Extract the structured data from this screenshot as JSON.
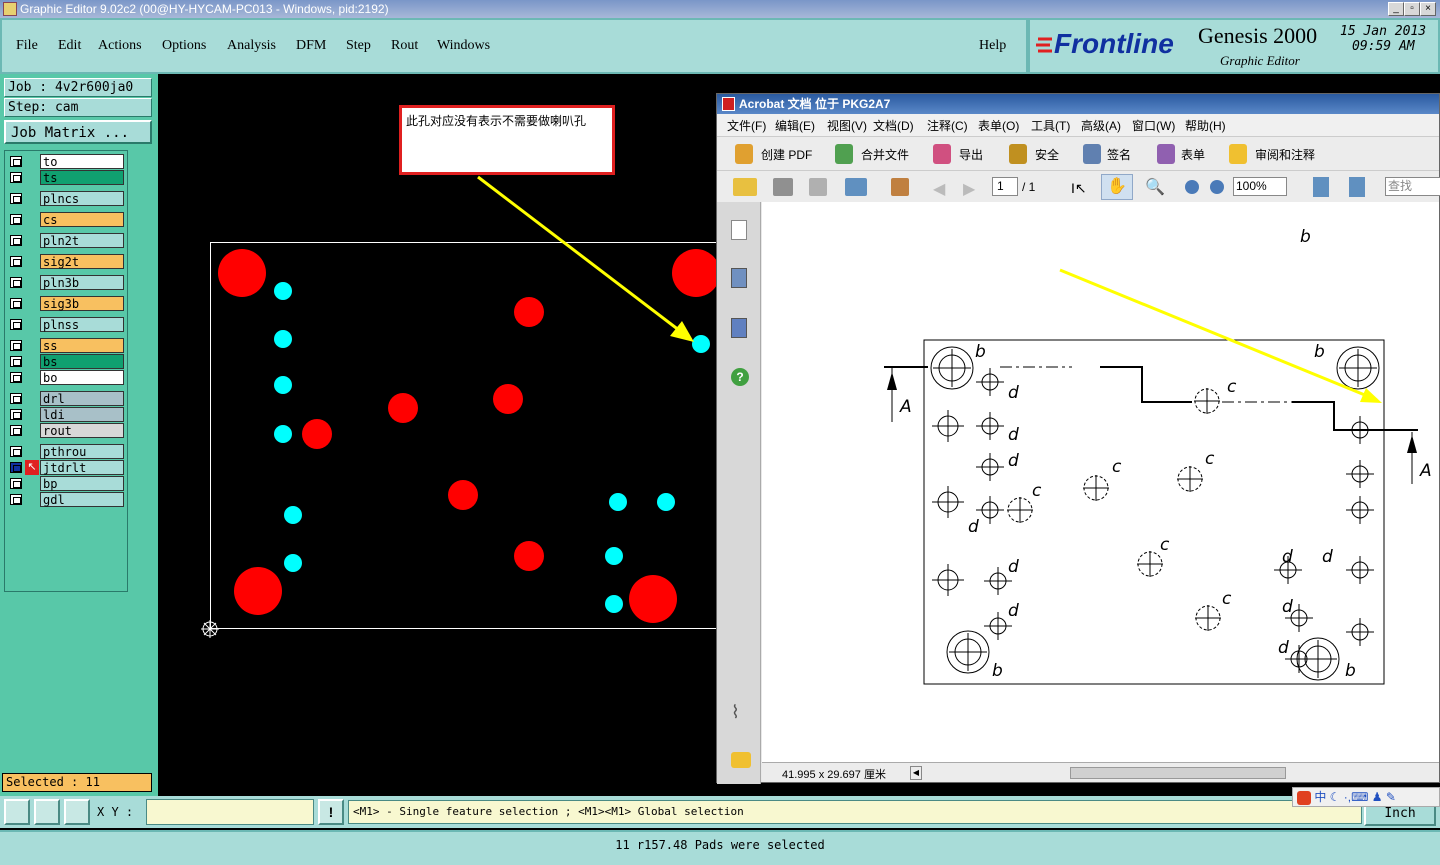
{
  "window": {
    "title": "Graphic Editor 9.02c2 (00@HY-HYCAM-PC013 - Windows, pid:2192)"
  },
  "menu": {
    "items": [
      "File",
      "Edit",
      "Actions",
      "Options",
      "Analysis",
      "DFM",
      "Step",
      "Rout",
      "Windows"
    ],
    "help": "Help"
  },
  "brand": {
    "logo": "Frontline",
    "product": "Genesis 2000",
    "subtitle": "Graphic Editor",
    "date": "15 Jan 2013",
    "time": "09:59 AM"
  },
  "job": {
    "job": "Job : 4v2r600ja0",
    "step": "Step: cam",
    "matrix_button": "Job Matrix ..."
  },
  "layers": [
    {
      "name": "to",
      "color": "#ffffff"
    },
    {
      "name": "ts",
      "color": "#10a070"
    },
    {
      "name": "plncs",
      "color": "#a8dcd8"
    },
    {
      "name": "cs",
      "color": "#f8c060"
    },
    {
      "name": "pln2t",
      "color": "#a8dcd8"
    },
    {
      "name": "sig2t",
      "color": "#f8c060"
    },
    {
      "name": "pln3b",
      "color": "#a8dcd8"
    },
    {
      "name": "sig3b",
      "color": "#f8c060"
    },
    {
      "name": "plnss",
      "color": "#a8dcd8"
    },
    {
      "name": "ss",
      "color": "#f8c060"
    },
    {
      "name": "bs",
      "color": "#10a070"
    },
    {
      "name": "bo",
      "color": "#ffffff"
    },
    {
      "name": "drl",
      "color": "#a8c0c8"
    },
    {
      "name": "ldi",
      "color": "#a8c0c8"
    },
    {
      "name": "rout",
      "color": "#d8d8d8"
    },
    {
      "name": "pthrou",
      "color": "#a8dcd8"
    },
    {
      "name": "jtdrlt",
      "color": "#a8dcd8"
    },
    {
      "name": "bp",
      "color": "#a8dcd8"
    },
    {
      "name": "gdl",
      "color": "#a8dcd8"
    }
  ],
  "selected": "Selected : 11",
  "annotation": "此孔对应没有表示不需要做喇叭孔",
  "xy": {
    "label": "X Y :",
    "value": ""
  },
  "hint": "<M1> - Single feature selection ; <M1><M1> Global selection",
  "units": "Inch",
  "status": "11 r157.48 Pads were selected",
  "acrobat": {
    "title": "Acrobat 文档 位于 PKG2A7",
    "menu": [
      "文件(F)",
      "编辑(E)",
      "视图(V)",
      "文档(D)",
      "注释(C)",
      "表单(O)",
      "工具(T)",
      "高级(A)",
      "窗口(W)",
      "帮助(H)"
    ],
    "toolbar": [
      "创建 PDF",
      "合并文件",
      "导出",
      "安全",
      "签名",
      "表单",
      "审阅和注释"
    ],
    "page": "1",
    "page_total": "/ 1",
    "zoom": "100%",
    "search_placeholder": "查找",
    "page_size": "41.995 x 29.697 厘米",
    "labels": {
      "b": "b",
      "c": "c",
      "d": "d",
      "A": "A"
    }
  }
}
